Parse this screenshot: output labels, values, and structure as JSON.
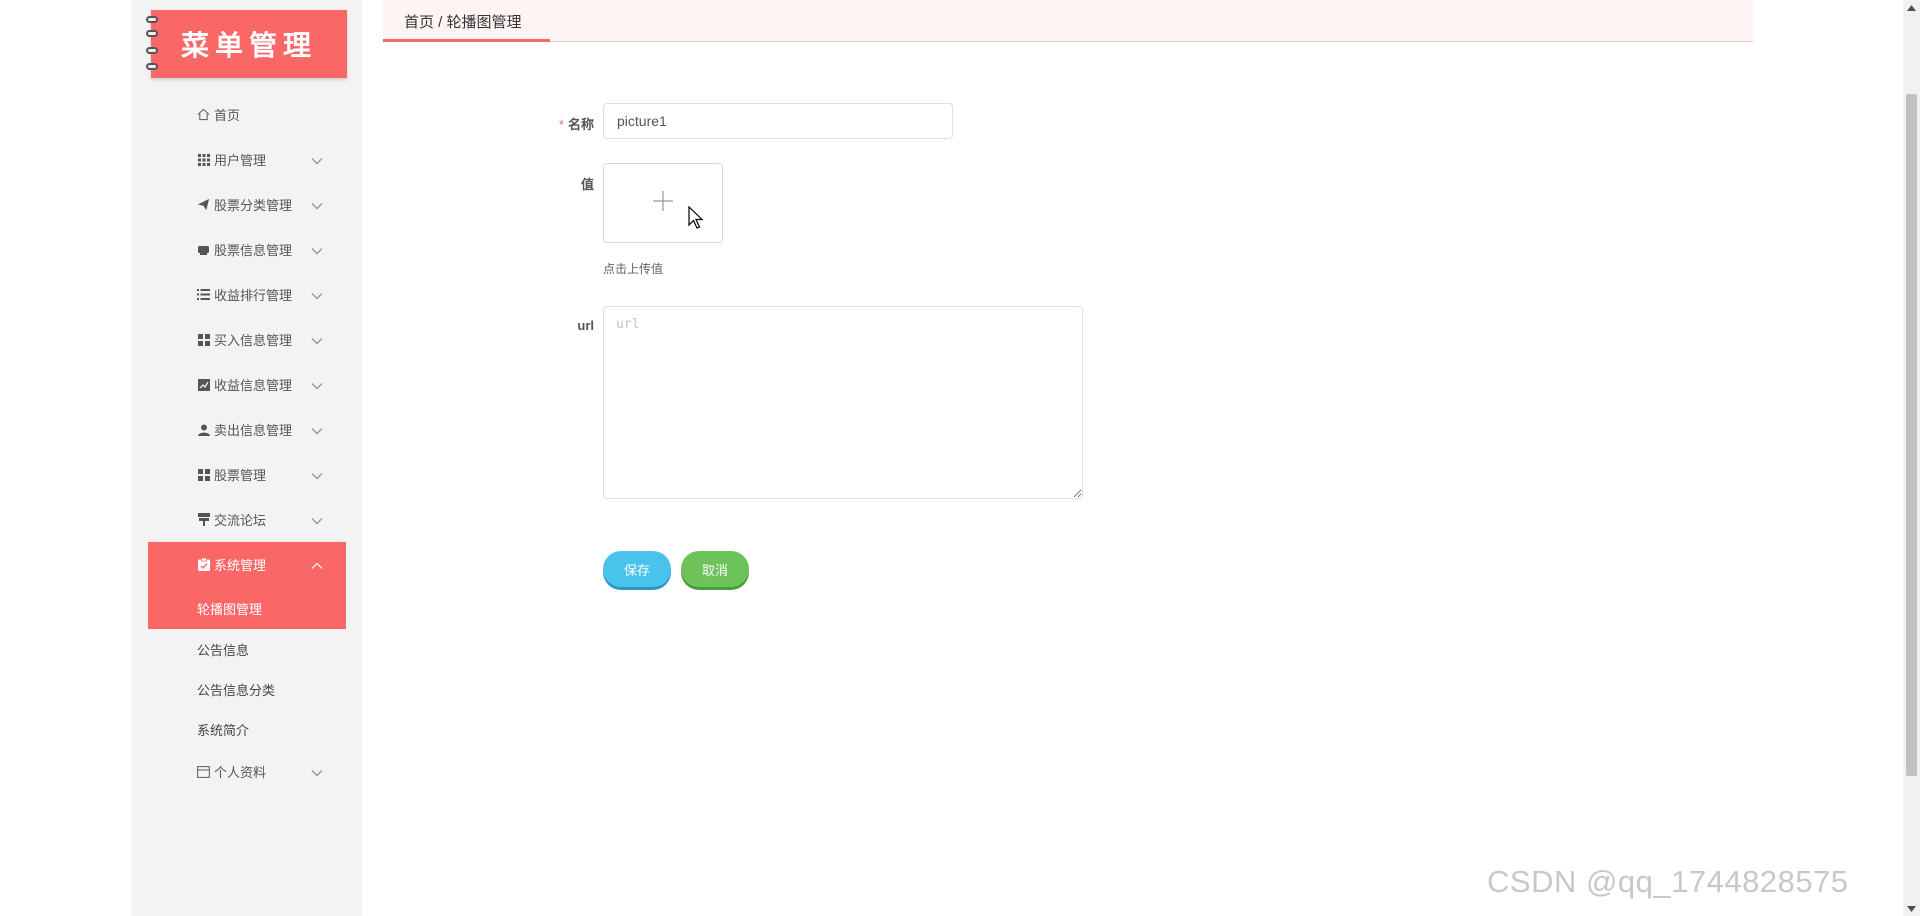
{
  "sidebar": {
    "title": "菜单管理",
    "items": [
      {
        "label": "首页",
        "icon": "home-icon",
        "expandable": false
      },
      {
        "label": "用户管理",
        "icon": "grid-icon",
        "expandable": true
      },
      {
        "label": "股票分类管理",
        "icon": "send-icon",
        "expandable": true
      },
      {
        "label": "股票信息管理",
        "icon": "printer-icon",
        "expandable": true
      },
      {
        "label": "收益排行管理",
        "icon": "list-icon",
        "expandable": true
      },
      {
        "label": "买入信息管理",
        "icon": "tiles-icon",
        "expandable": true
      },
      {
        "label": "收益信息管理",
        "icon": "chart-icon",
        "expandable": true
      },
      {
        "label": "卖出信息管理",
        "icon": "user-icon",
        "expandable": true
      },
      {
        "label": "股票管理",
        "icon": "tiles-icon",
        "expandable": true
      },
      {
        "label": "交流论坛",
        "icon": "sign-icon",
        "expandable": true
      }
    ],
    "active_group": {
      "label": "系统管理",
      "icon": "clipboard-icon",
      "children": [
        "轮播图管理",
        "公告信息",
        "公告信息分类",
        "系统简介"
      ]
    },
    "last_item": {
      "label": "个人资料",
      "icon": "card-icon"
    }
  },
  "breadcrumb": "首页 / 轮播图管理",
  "form": {
    "name_label": "名称",
    "name_value": "picture1",
    "value_label": "值",
    "upload_tip": "点击上传值",
    "url_label": "url",
    "url_placeholder": "url",
    "save_label": "保存",
    "cancel_label": "取消"
  },
  "watermark": "CSDN @qq_1744828575",
  "colors": {
    "accent": "#fa6767",
    "save": "#49c3ec",
    "cancel": "#6ec25a"
  }
}
